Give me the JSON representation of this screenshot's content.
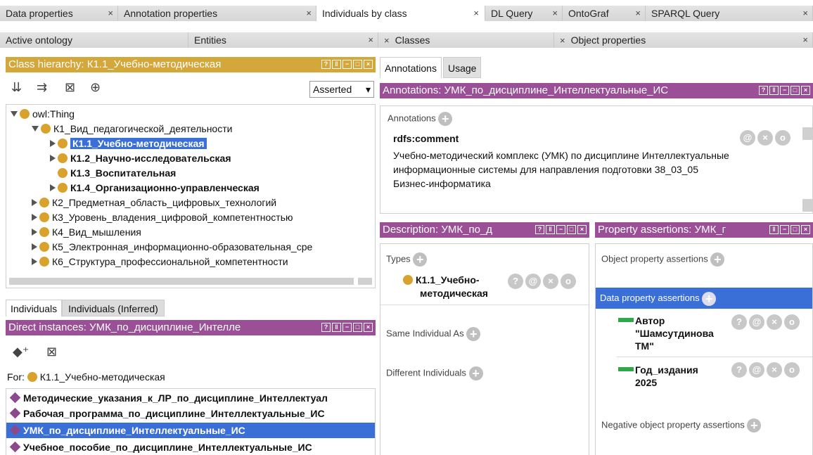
{
  "tabs_top": [
    {
      "label": "Data properties",
      "width": 168
    },
    {
      "label": "Annotation properties",
      "width": 282
    },
    {
      "label": "Individuals by class",
      "width": 240,
      "active": true
    },
    {
      "label": "DL Query",
      "width": 110
    },
    {
      "label": "OntoGraf",
      "width": 118
    },
    {
      "label": "SPARQL Query",
      "width": 238
    }
  ],
  "tabs_second": [
    {
      "label": "Active ontology"
    },
    {
      "label": "Entities"
    },
    {
      "label": "Classes"
    },
    {
      "label": "Object properties"
    }
  ],
  "class_hierarchy": {
    "title": "Class hierarchy: К1.1_Учебно-методическая",
    "mode": "Asserted",
    "root": "owl:Thing",
    "items": [
      "К1_Вид_педагогической_деятельности",
      "К1.1_Учебно-методическая",
      "К1.2_Научно-исследовательская",
      "К1.3_Воспитательная",
      "К1.4_Организационно-управленческая",
      "К2_Предметная_область_цифровых_технологий",
      "К3_Уровень_владения_цифровой_компетентностью",
      "К4_Вид_мышления",
      "К5_Электронная_информационно-образовательная_сре",
      "К6_Структура_профессиональной_компетентности"
    ]
  },
  "individuals_tabs": [
    "Individuals",
    "Individuals (Inferred)"
  ],
  "direct_instances": {
    "title": "Direct instances: УМК_по_дисциплине_Интелле",
    "for_label": "For:",
    "for_class": "К1.1_Учебно-методическая",
    "items": [
      "Методические_указания_к_ЛР_по_дисциплине_Интеллектуал",
      "Рабочая_программа_по_дисциплине_Интеллектуальные_ИС",
      "УМК_по_дисциплине_Интеллектуальные_ИС",
      "Учебное_пособие_по_дисциплине_Интеллектуальные_ИС"
    ]
  },
  "right_tabs": [
    "Annotations",
    "Usage"
  ],
  "annotations": {
    "title": "Annotations: УМК_по_дисциплине_Интеллектуальные_ИС",
    "label": "Annotations",
    "property": "rdfs:comment",
    "lines": [
      "Учебно-методический комплекс (УМК) по дисциплине Интеллектуальные",
      "информационные системы для направления подготовки 38_03_05",
      "Бизнес-информатика"
    ]
  },
  "description": {
    "title": "Description: УМК_по_д",
    "types_label": "Types",
    "type_line1": "К1.1_Учебно-",
    "type_line2": "методическая",
    "same_as": "Same Individual As",
    "different": "Different Individuals"
  },
  "property_assertions": {
    "title": "Property assertions: УМК_г",
    "object_label": "Object property assertions",
    "data_label": "Data property assertions",
    "a1_line1": "Автор",
    "a1_line2": "\"Шамсутдинова",
    "a1_line3": "ТМ\"",
    "a2_line1": "Год_издания",
    "a2_line2": "2025",
    "negative_label": "Negative object property assertions"
  },
  "buttons": {
    "help": "?",
    "at": "@",
    "x": "×",
    "o": "o"
  },
  "colors": {
    "gold": "#d4a73a",
    "purple": "#9a4f97",
    "selection": "#3a6fd8",
    "green": "#2ea84a"
  }
}
